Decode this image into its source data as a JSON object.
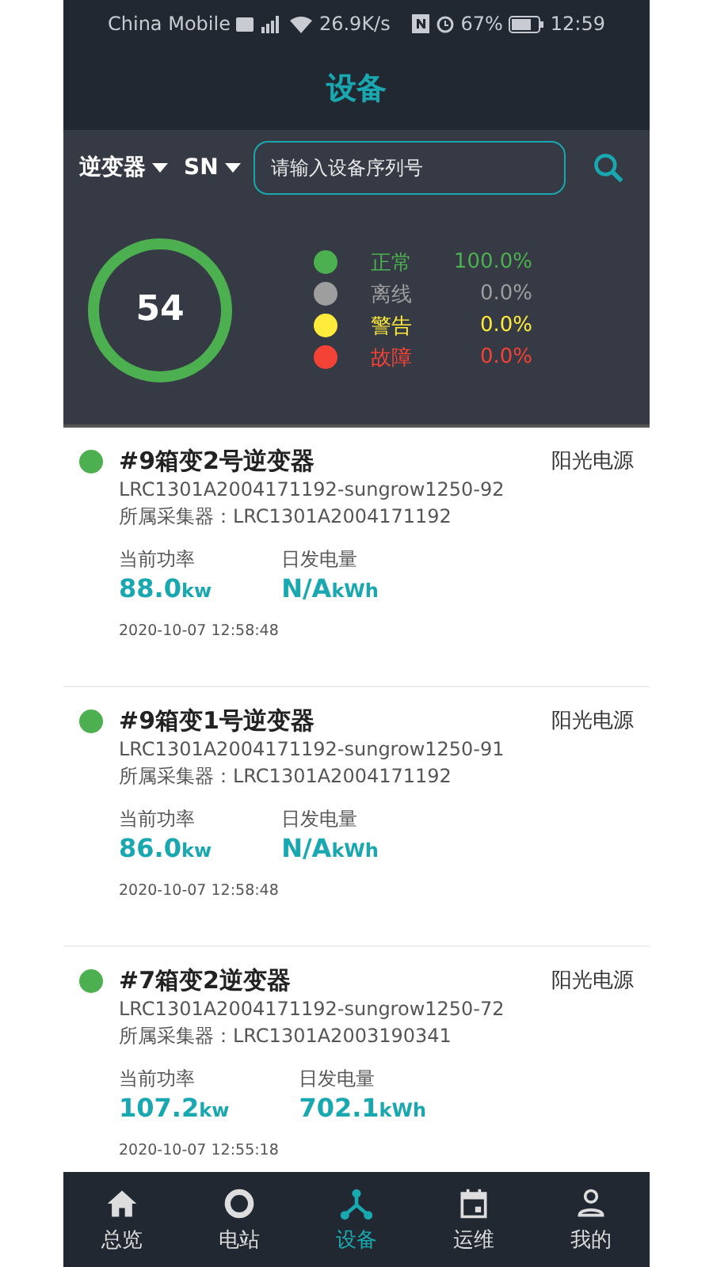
{
  "status_bar": {
    "carrier": "China Mobile",
    "speed": "26.9K/s",
    "battery": "67%",
    "time": "12:59"
  },
  "header": {
    "title": "设备"
  },
  "filters": [
    {
      "label": "逆变器"
    },
    {
      "label": "SN"
    }
  ],
  "search": {
    "placeholder": "请输入设备序列号"
  },
  "summary": {
    "count": "54",
    "legend": [
      {
        "label": "正常",
        "value": "100.0%",
        "color": "#4caf50"
      },
      {
        "label": "离线",
        "value": "0.0%",
        "color": "#9e9e9e"
      },
      {
        "label": "警告",
        "value": "0.0%",
        "color": "#ffeb3b"
      },
      {
        "label": "故障",
        "value": "0.0%",
        "color": "#f44336"
      }
    ]
  },
  "devices": [
    {
      "name": "#9箱变2号逆变器",
      "brand": "阳光电源",
      "sn": "LRC1301A2004171192-sungrow1250-92",
      "collector": "所属采集器：LRC1301A2004171192",
      "power_label": "当前功率",
      "power": "88.0",
      "power_unit": "kw",
      "energy_label": "日发电量",
      "energy": "N/A",
      "energy_unit": "kWh",
      "time": "2020-10-07 12:58:48",
      "color": "#4caf50"
    },
    {
      "name": "#9箱变1号逆变器",
      "brand": "阳光电源",
      "sn": "LRC1301A2004171192-sungrow1250-91",
      "collector": "所属采集器：LRC1301A2004171192",
      "power_label": "当前功率",
      "power": "86.0",
      "power_unit": "kw",
      "energy_label": "日发电量",
      "energy": "N/A",
      "energy_unit": "kWh",
      "time": "2020-10-07 12:58:48",
      "color": "#4caf50"
    },
    {
      "name": "#7箱变2逆变器",
      "brand": "阳光电源",
      "sn": "LRC1301A2004171192-sungrow1250-72",
      "collector": "所属采集器：LRC1301A2003190341",
      "power_label": "当前功率",
      "power": "107.2",
      "power_unit": "kw",
      "energy_label": "日发电量",
      "energy": "702.1",
      "energy_unit": "kWh",
      "time": "2020-10-07 12:55:18",
      "color": "#4caf50"
    }
  ],
  "nav": [
    {
      "label": "总览",
      "kind": "home",
      "selected": false
    },
    {
      "label": "电站",
      "kind": "ring",
      "selected": false
    },
    {
      "label": "设备",
      "kind": "nodes",
      "selected": true
    },
    {
      "label": "运维",
      "kind": "calendar",
      "selected": false
    },
    {
      "label": "我的",
      "kind": "user",
      "selected": false
    }
  ]
}
